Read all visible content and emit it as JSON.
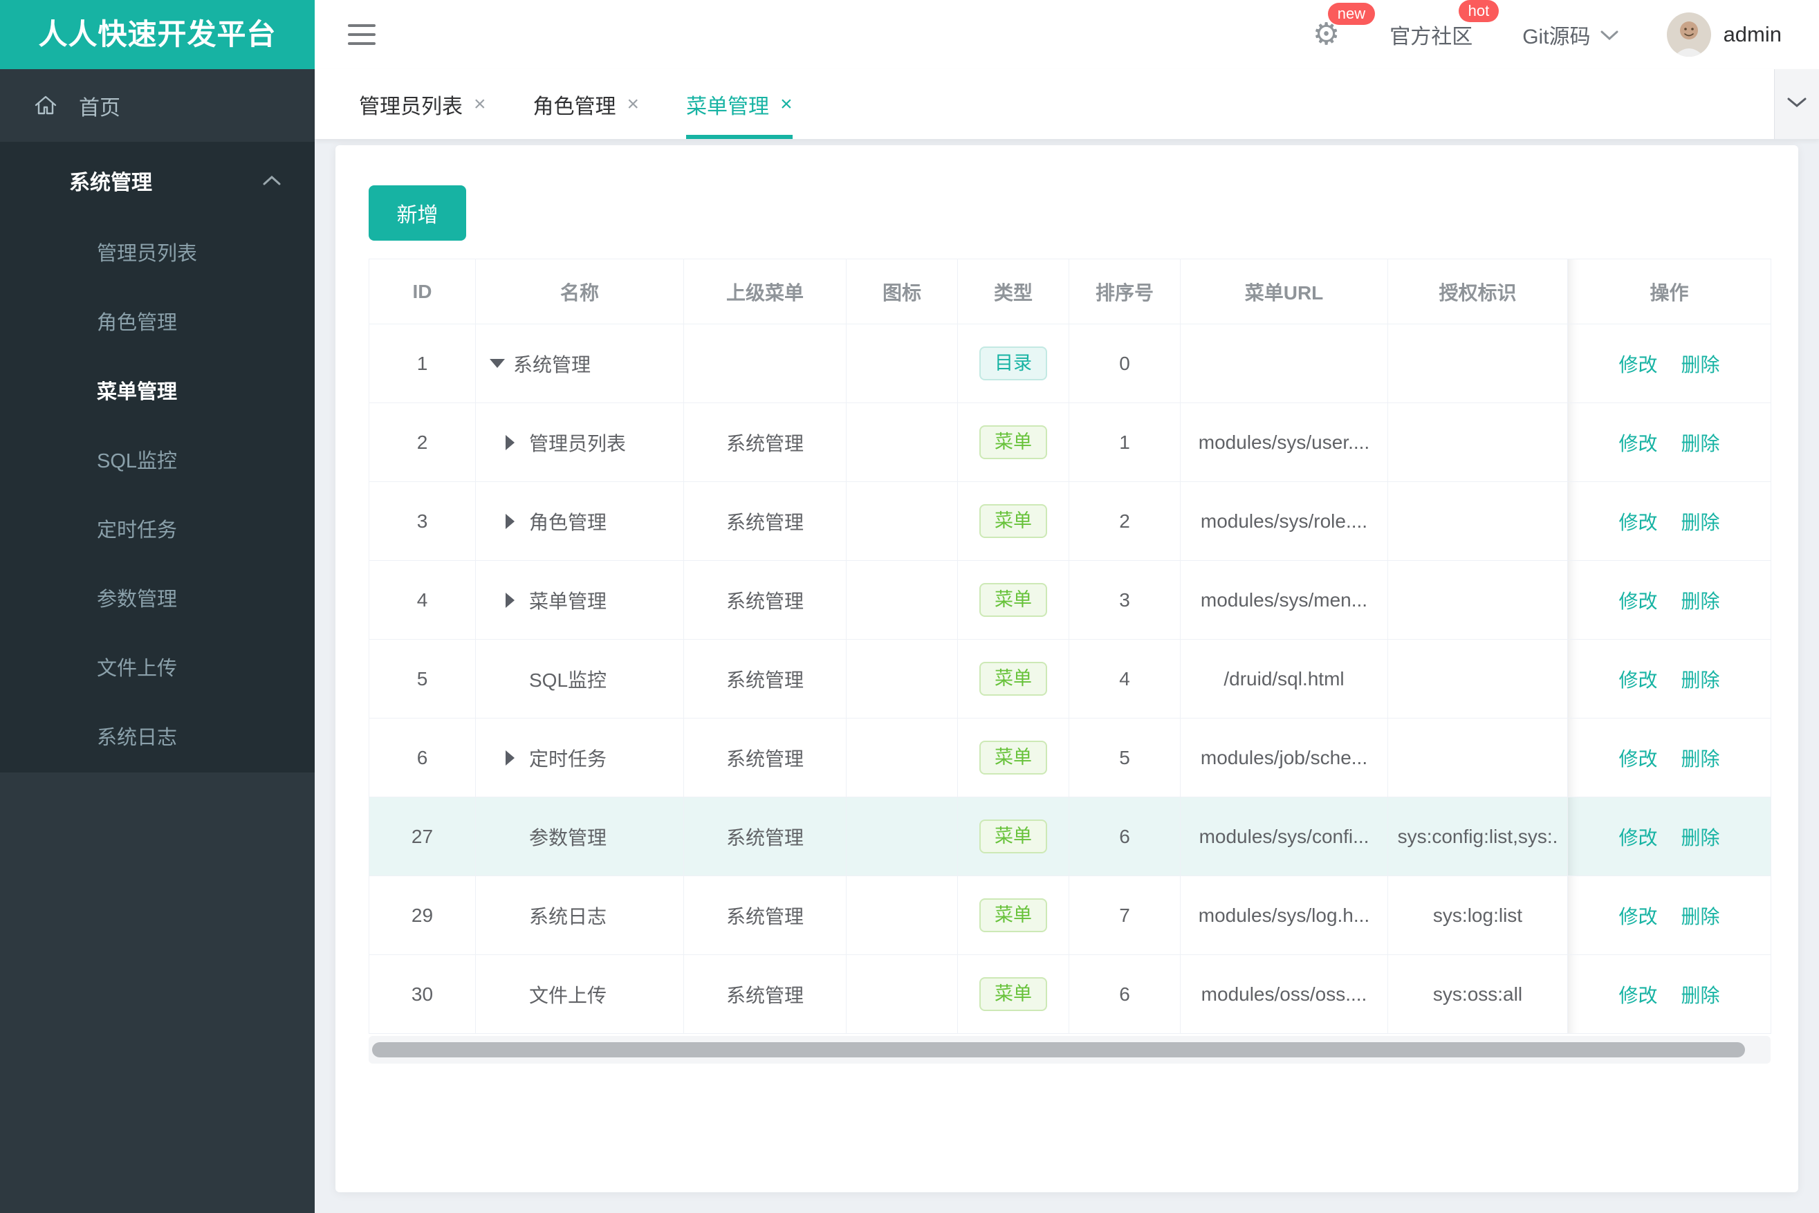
{
  "app_title": "人人快速开发平台",
  "header": {
    "logo_text": "人人快速开发平台",
    "settings_badge": "new",
    "community_label": "官方社区",
    "community_badge": "hot",
    "git_label": "Git源码",
    "username": "admin"
  },
  "sidebar": {
    "home_label": "首页",
    "group": {
      "label": "系统管理",
      "items": [
        "管理员列表",
        "角色管理",
        "菜单管理",
        "SQL监控",
        "定时任务",
        "参数管理",
        "文件上传",
        "系统日志"
      ],
      "active_item": "菜单管理"
    }
  },
  "tabs": [
    {
      "label": "管理员列表",
      "close": "×",
      "active": false
    },
    {
      "label": "角色管理",
      "close": "×",
      "active": false
    },
    {
      "label": "菜单管理",
      "close": "×",
      "active": true
    }
  ],
  "toolbar": {
    "add_label": "新增"
  },
  "table": {
    "columns": [
      "ID",
      "名称",
      "上级菜单",
      "图标",
      "类型",
      "排序号",
      "菜单URL",
      "授权标识",
      "操作"
    ],
    "action_labels": {
      "edit": "修改",
      "delete": "删除"
    },
    "rows": [
      {
        "id": "1",
        "name": "系统管理",
        "level": 1,
        "arrow": "down",
        "parent": "",
        "type_label": "目录",
        "type_kind": "dir",
        "order": "0",
        "url": "",
        "perms": "",
        "highlight": false
      },
      {
        "id": "2",
        "name": "管理员列表",
        "level": 2,
        "arrow": "right",
        "parent": "系统管理",
        "type_label": "菜单",
        "type_kind": "menu",
        "order": "1",
        "url": "modules/sys/user....",
        "perms": "",
        "highlight": false
      },
      {
        "id": "3",
        "name": "角色管理",
        "level": 2,
        "arrow": "right",
        "parent": "系统管理",
        "type_label": "菜单",
        "type_kind": "menu",
        "order": "2",
        "url": "modules/sys/role....",
        "perms": "",
        "highlight": false
      },
      {
        "id": "4",
        "name": "菜单管理",
        "level": 2,
        "arrow": "right",
        "parent": "系统管理",
        "type_label": "菜单",
        "type_kind": "menu",
        "order": "3",
        "url": "modules/sys/men...",
        "perms": "",
        "highlight": false
      },
      {
        "id": "5",
        "name": "SQL监控",
        "level": 2,
        "arrow": "none",
        "parent": "系统管理",
        "type_label": "菜单",
        "type_kind": "menu",
        "order": "4",
        "url": "/druid/sql.html",
        "perms": "",
        "highlight": false
      },
      {
        "id": "6",
        "name": "定时任务",
        "level": 2,
        "arrow": "right",
        "parent": "系统管理",
        "type_label": "菜单",
        "type_kind": "menu",
        "order": "5",
        "url": "modules/job/sche...",
        "perms": "",
        "highlight": false
      },
      {
        "id": "27",
        "name": "参数管理",
        "level": 2,
        "arrow": "none",
        "parent": "系统管理",
        "type_label": "菜单",
        "type_kind": "menu",
        "order": "6",
        "url": "modules/sys/confi...",
        "perms": "sys:config:list,sys:.",
        "highlight": true
      },
      {
        "id": "29",
        "name": "系统日志",
        "level": 2,
        "arrow": "none",
        "parent": "系统管理",
        "type_label": "菜单",
        "type_kind": "menu",
        "order": "7",
        "url": "modules/sys/log.h...",
        "perms": "sys:log:list",
        "highlight": false
      },
      {
        "id": "30",
        "name": "文件上传",
        "level": 2,
        "arrow": "none",
        "parent": "系统管理",
        "type_label": "菜单",
        "type_kind": "menu",
        "order": "6",
        "url": "modules/oss/oss....",
        "perms": "sys:oss:all",
        "highlight": false
      }
    ]
  },
  "colors": {
    "brand_teal": "#17b3a3",
    "sidebar_base": "#2e3940",
    "sidebar_submenu": "#232e34",
    "badge_red": "#fb5b5b",
    "tag_dir_text": "#17b3a3",
    "tag_menu_text": "#67c23a",
    "highlight_row": "#e9f6f5"
  }
}
